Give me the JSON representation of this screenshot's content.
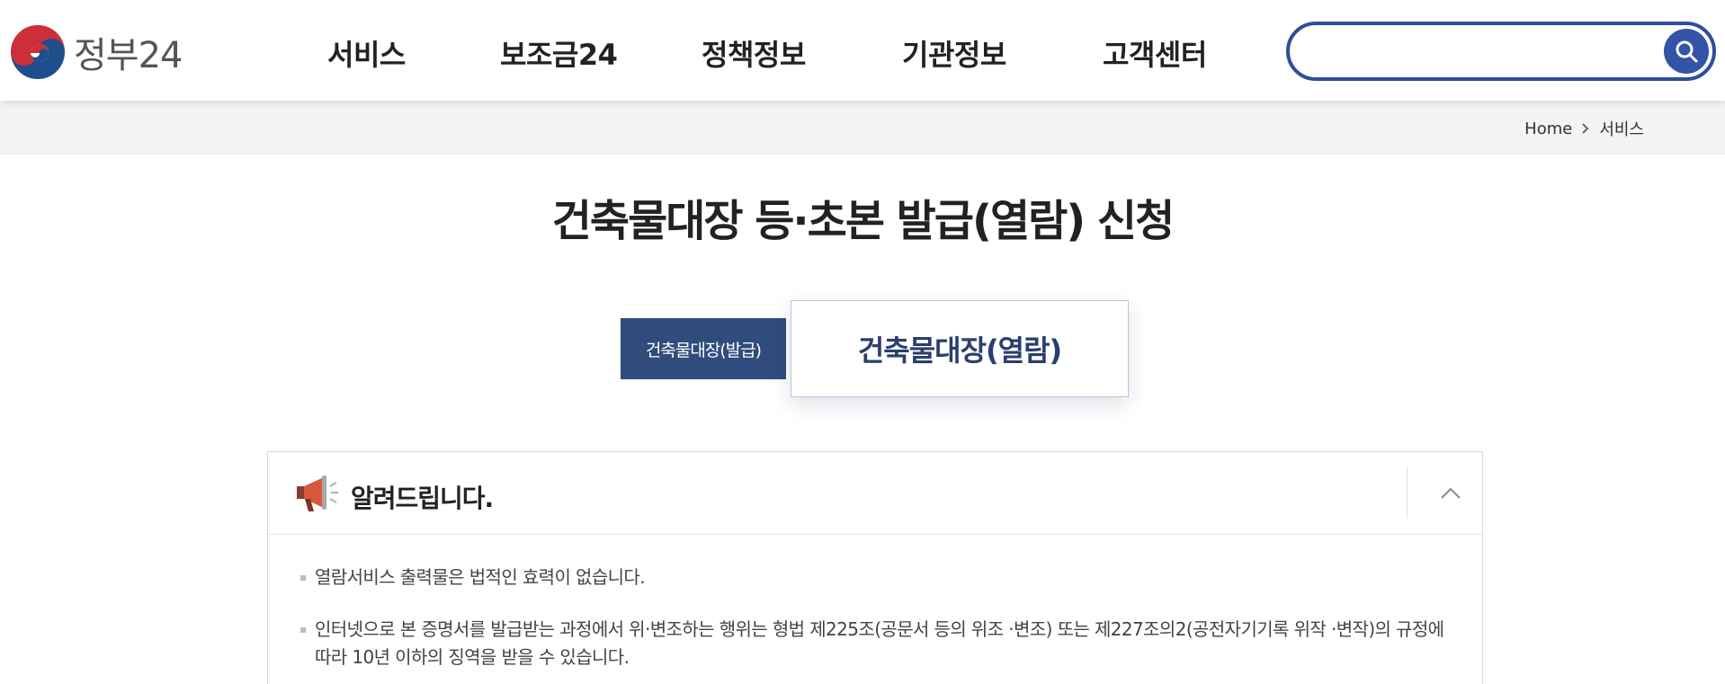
{
  "header": {
    "logo_text": "정부24",
    "nav": [
      "서비스",
      "보조금24",
      "정책정보",
      "기관정보",
      "고객센터"
    ],
    "search": {
      "value": "",
      "placeholder": ""
    },
    "colors": {
      "accent": "#2f4d9c",
      "logo_red": "#cd2e3a",
      "logo_blue": "#1f4e8c"
    }
  },
  "breadcrumb": {
    "home": "Home",
    "current": "서비스"
  },
  "page_title": "건축물대장 등·초본 발급(열람) 신청",
  "tabs": [
    {
      "label": "건축물대장(발급)",
      "active": false
    },
    {
      "label": "건축물대장(열람)",
      "active": true
    }
  ],
  "notice": {
    "title": "알려드립니다.",
    "icon": "megaphone-icon",
    "items": [
      "열람서비스 출력물은 법적인 효력이 없습니다.",
      "인터넷으로 본 증명서를 발급받는 과정에서 위·변조하는 행위는 형법 제225조(공문서 등의 위조 ·변조) 또는 제227조의2(공전자기기록 위작 ·변작)의 규정에 따라 10년 이하의 징역을 받을 수 있습니다."
    ],
    "expanded": true
  }
}
